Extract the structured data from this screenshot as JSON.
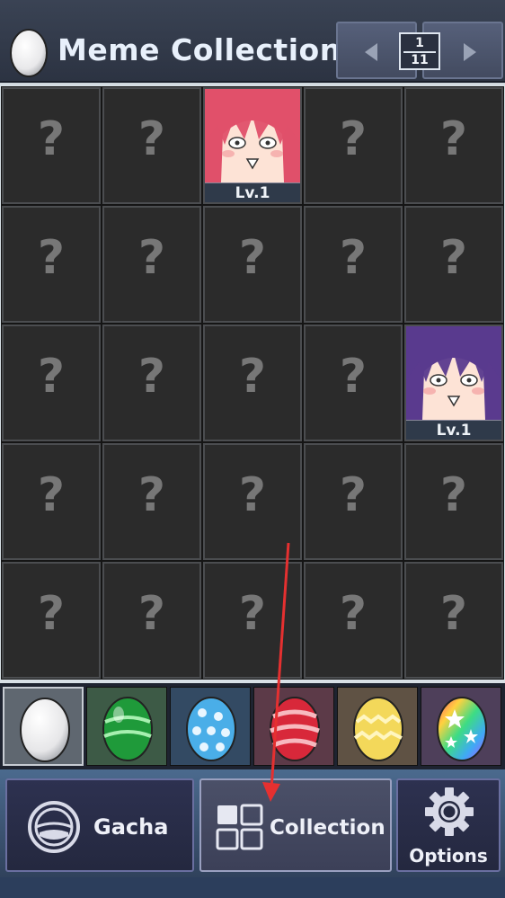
{
  "header": {
    "title": "Meme Collection",
    "page_current": "1",
    "page_total": "11"
  },
  "grid": {
    "columns": 5,
    "rows": 5,
    "locked_symbol": "?",
    "unlocked": [
      {
        "row": 0,
        "col": 2,
        "level": "Lv.1",
        "hair": "#e0506a"
      },
      {
        "row": 2,
        "col": 4,
        "level": "Lv.1",
        "hair": "#5a3a8e"
      }
    ]
  },
  "egg_tabs": [
    {
      "name": "white-egg",
      "bg": "#5f6770",
      "selected": true
    },
    {
      "name": "green-striped-egg",
      "bg": "#3d5a46",
      "selected": false
    },
    {
      "name": "blue-spotted-egg",
      "bg": "#334a63",
      "selected": false
    },
    {
      "name": "red-striped-egg",
      "bg": "#5c3a48",
      "selected": false
    },
    {
      "name": "yellow-zigzag-egg",
      "bg": "#5f5244",
      "selected": false
    },
    {
      "name": "rainbow-star-egg",
      "bg": "#4e3f5a",
      "selected": false
    }
  ],
  "nav": {
    "gacha_label": "Gacha",
    "collection_label": "Collection",
    "options_label": "Options"
  },
  "colors": {
    "annotation_arrow": "#e53030"
  }
}
